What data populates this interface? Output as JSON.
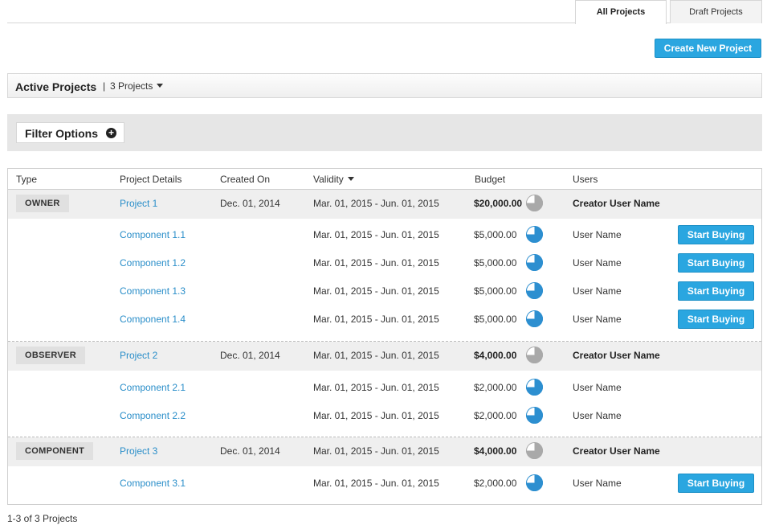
{
  "tabs": {
    "all": "All Projects",
    "draft": "Draft Projects"
  },
  "create_button": "Create New Project",
  "active": {
    "title": "Active Projects",
    "separator": "|",
    "count": "3 Projects"
  },
  "filter": {
    "label": "Filter Options",
    "plus": "+"
  },
  "table": {
    "headers": {
      "type": "Type",
      "details": "Project Details",
      "created": "Created On",
      "validity": "Validity",
      "budget": "Budget",
      "users": "Users"
    }
  },
  "groups": [
    {
      "type": "OWNER",
      "project": {
        "name": "Project 1",
        "created": "Dec. 01, 2014",
        "validity": "Mar. 01, 2015 - Jun. 01, 2015",
        "budget": "$20,000.00",
        "user": "Creator User Name"
      },
      "components": [
        {
          "name": "Component 1.1",
          "validity": "Mar. 01, 2015 - Jun. 01, 2015",
          "budget": "$5,000.00",
          "user": "User Name",
          "action": "Start Buying"
        },
        {
          "name": "Component 1.2",
          "validity": "Mar. 01, 2015 - Jun. 01, 2015",
          "budget": "$5,000.00",
          "user": "User Name",
          "action": "Start Buying"
        },
        {
          "name": "Component 1.3",
          "validity": "Mar. 01, 2015 - Jun. 01, 2015",
          "budget": "$5,000.00",
          "user": "User Name",
          "action": "Start Buying"
        },
        {
          "name": "Component 1.4",
          "validity": "Mar. 01, 2015 - Jun. 01, 2015",
          "budget": "$5,000.00",
          "user": "User Name",
          "action": "Start Buying"
        }
      ]
    },
    {
      "type": "OBSERVER",
      "project": {
        "name": "Project 2",
        "created": "Dec. 01, 2014",
        "validity": "Mar. 01, 2015 - Jun. 01, 2015",
        "budget": "$4,000.00",
        "user": "Creator User Name"
      },
      "components": [
        {
          "name": "Component 2.1",
          "validity": "Mar. 01, 2015 - Jun. 01, 2015",
          "budget": "$2,000.00",
          "user": "User Name"
        },
        {
          "name": "Component 2.2",
          "validity": "Mar. 01, 2015 - Jun. 01, 2015",
          "budget": "$2,000.00",
          "user": "User Name"
        }
      ]
    },
    {
      "type": "COMPONENT",
      "project": {
        "name": "Project 3",
        "created": "Dec. 01, 2014",
        "validity": "Mar. 01, 2015 - Jun. 01, 2015",
        "budget": "$4,000.00",
        "user": "Creator User Name"
      },
      "components": [
        {
          "name": "Component 3.1",
          "validity": "Mar. 01, 2015 - Jun. 01, 2015",
          "budget": "$2,000.00",
          "user": "User Name",
          "action": "Start Buying"
        }
      ]
    }
  ],
  "footer": "1-3 of 3 Projects",
  "colors": {
    "accent": "#2aa6e0",
    "link": "#2a8ec9",
    "pie_parent": "#a9a9a9",
    "pie_component": "#2d8fd0"
  },
  "icons": {
    "filter": "plus-circle-icon",
    "sort": "caret-down-icon",
    "budget": "pie-chart-icon"
  }
}
